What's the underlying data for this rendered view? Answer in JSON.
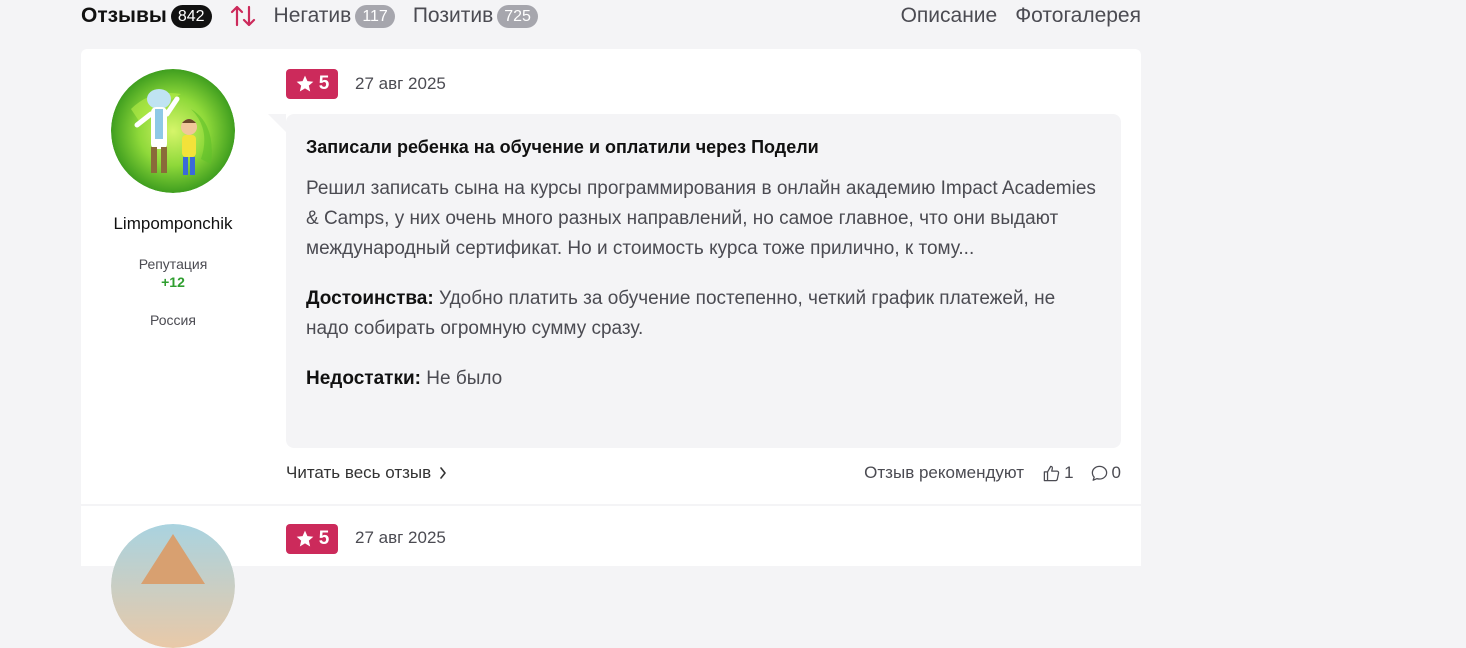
{
  "tabs": {
    "reviews_label": "Отзывы",
    "reviews_count": "842",
    "negative_label": "Негатив",
    "negative_count": "117",
    "positive_label": "Позитив",
    "positive_count": "725",
    "description_label": "Описание",
    "gallery_label": "Фотогалерея"
  },
  "review": {
    "author": "Limpomponchik",
    "reputation_label": "Репутация",
    "reputation_value": "+12",
    "country": "Россия",
    "rating": "5",
    "date": "27 авг 2025",
    "title": "Записали ребенка на обучение и оплатили через Подели",
    "text": "Решил записать сына на курсы программирования в онлайн академию Impact Academies & Camps, у них очень много разных направлений, но самое главное, что они выдают международный сертификат. Но и стоимость курса тоже прилично, к тому...",
    "pros_label": "Достоинства:",
    "pros_text": "Удобно платить за обучение постепенно, четкий график платежей, не надо собирать огромную сумму сразу.",
    "cons_label": "Недостатки:",
    "cons_text": "Не было",
    "read_more": "Читать весь отзыв",
    "recommend_label": "Отзыв рекомендуют",
    "likes": "1",
    "comments": "0"
  },
  "review2": {
    "rating": "5",
    "date": "27 авг 2025"
  },
  "colors": {
    "accent": "#cc2a5b",
    "reputation": "#2f9e2f"
  },
  "icons": {
    "sort": "sort-arrows-icon",
    "star": "star-icon",
    "chevron": "chevron-right-icon",
    "like": "thumbs-up-icon",
    "comment": "comment-icon"
  }
}
